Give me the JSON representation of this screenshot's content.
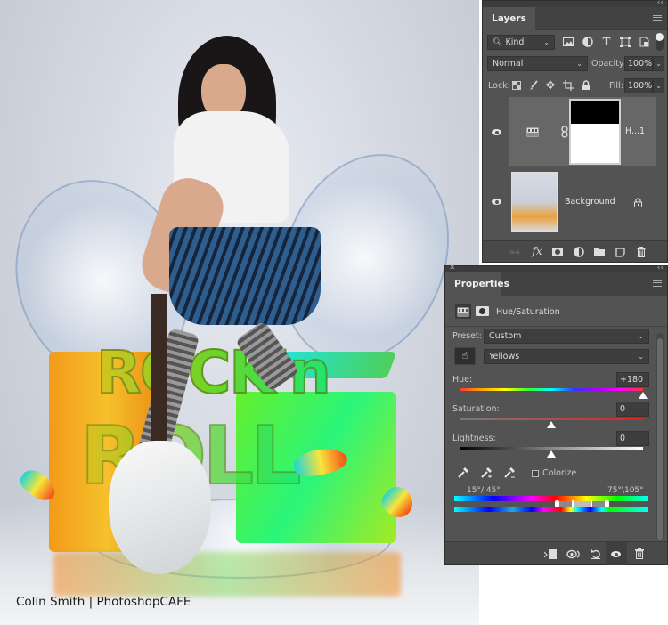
{
  "canvas": {
    "credit_text": "Colin Smith | PhotoshopCAFE",
    "artwork_text": [
      "ROCK'n",
      "ROLL"
    ]
  },
  "layers_panel": {
    "tab_label": "Layers",
    "filter": {
      "icon": "search-icon",
      "value": "Kind"
    },
    "filter_icons": [
      "pixel-layer-filter-icon",
      "adjustment-layer-filter-icon",
      "type-layer-filter-icon",
      "shape-layer-filter-icon",
      "smart-object-filter-icon"
    ],
    "blend_mode": "Normal",
    "opacity_label": "Opacity:",
    "opacity_value": "100%",
    "lock_label": "Lock:",
    "lock_icons": [
      "lock-transparent-pixels-icon",
      "lock-image-pixels-icon",
      "lock-position-icon",
      "lock-artboard-icon",
      "lock-all-icon"
    ],
    "fill_label": "Fill:",
    "fill_value": "100%",
    "layers": [
      {
        "name": "H...1",
        "type": "hue-saturation-adjustment",
        "visible": true,
        "selected": true
      },
      {
        "name": "Background",
        "type": "pixel",
        "visible": true,
        "locked": true,
        "selected": false
      }
    ],
    "bottom_icons": [
      "link-layers-icon",
      "fx-icon",
      "add-mask-icon",
      "new-adjustment-icon",
      "new-group-icon",
      "new-layer-icon",
      "delete-icon"
    ]
  },
  "properties_panel": {
    "tab_label": "Properties",
    "adjustment_title": "Hue/Saturation",
    "preset_label": "Preset:",
    "preset_value": "Custom",
    "channel_value": "Yellows",
    "hue": {
      "label": "Hue:",
      "value": "+180",
      "fraction": 1.0
    },
    "saturation": {
      "label": "Saturation:",
      "value": "0",
      "fraction": 0.5
    },
    "lightness": {
      "label": "Lightness:",
      "value": "0",
      "fraction": 0.5
    },
    "colorize_label": "Colorize",
    "colorize_checked": false,
    "range_left": "15°/ 45°",
    "range_right": "75°\\105°",
    "bottom_icons": [
      "clip-to-layer-icon",
      "view-previous-state-icon",
      "reset-icon",
      "toggle-visibility-icon",
      "delete-icon"
    ]
  },
  "colors": {
    "panel_bg": "#535353",
    "panel_dark": "#424242",
    "field_bg": "#3e3e3e",
    "selected_layer": "#676767",
    "text": "#d8d8d8"
  }
}
